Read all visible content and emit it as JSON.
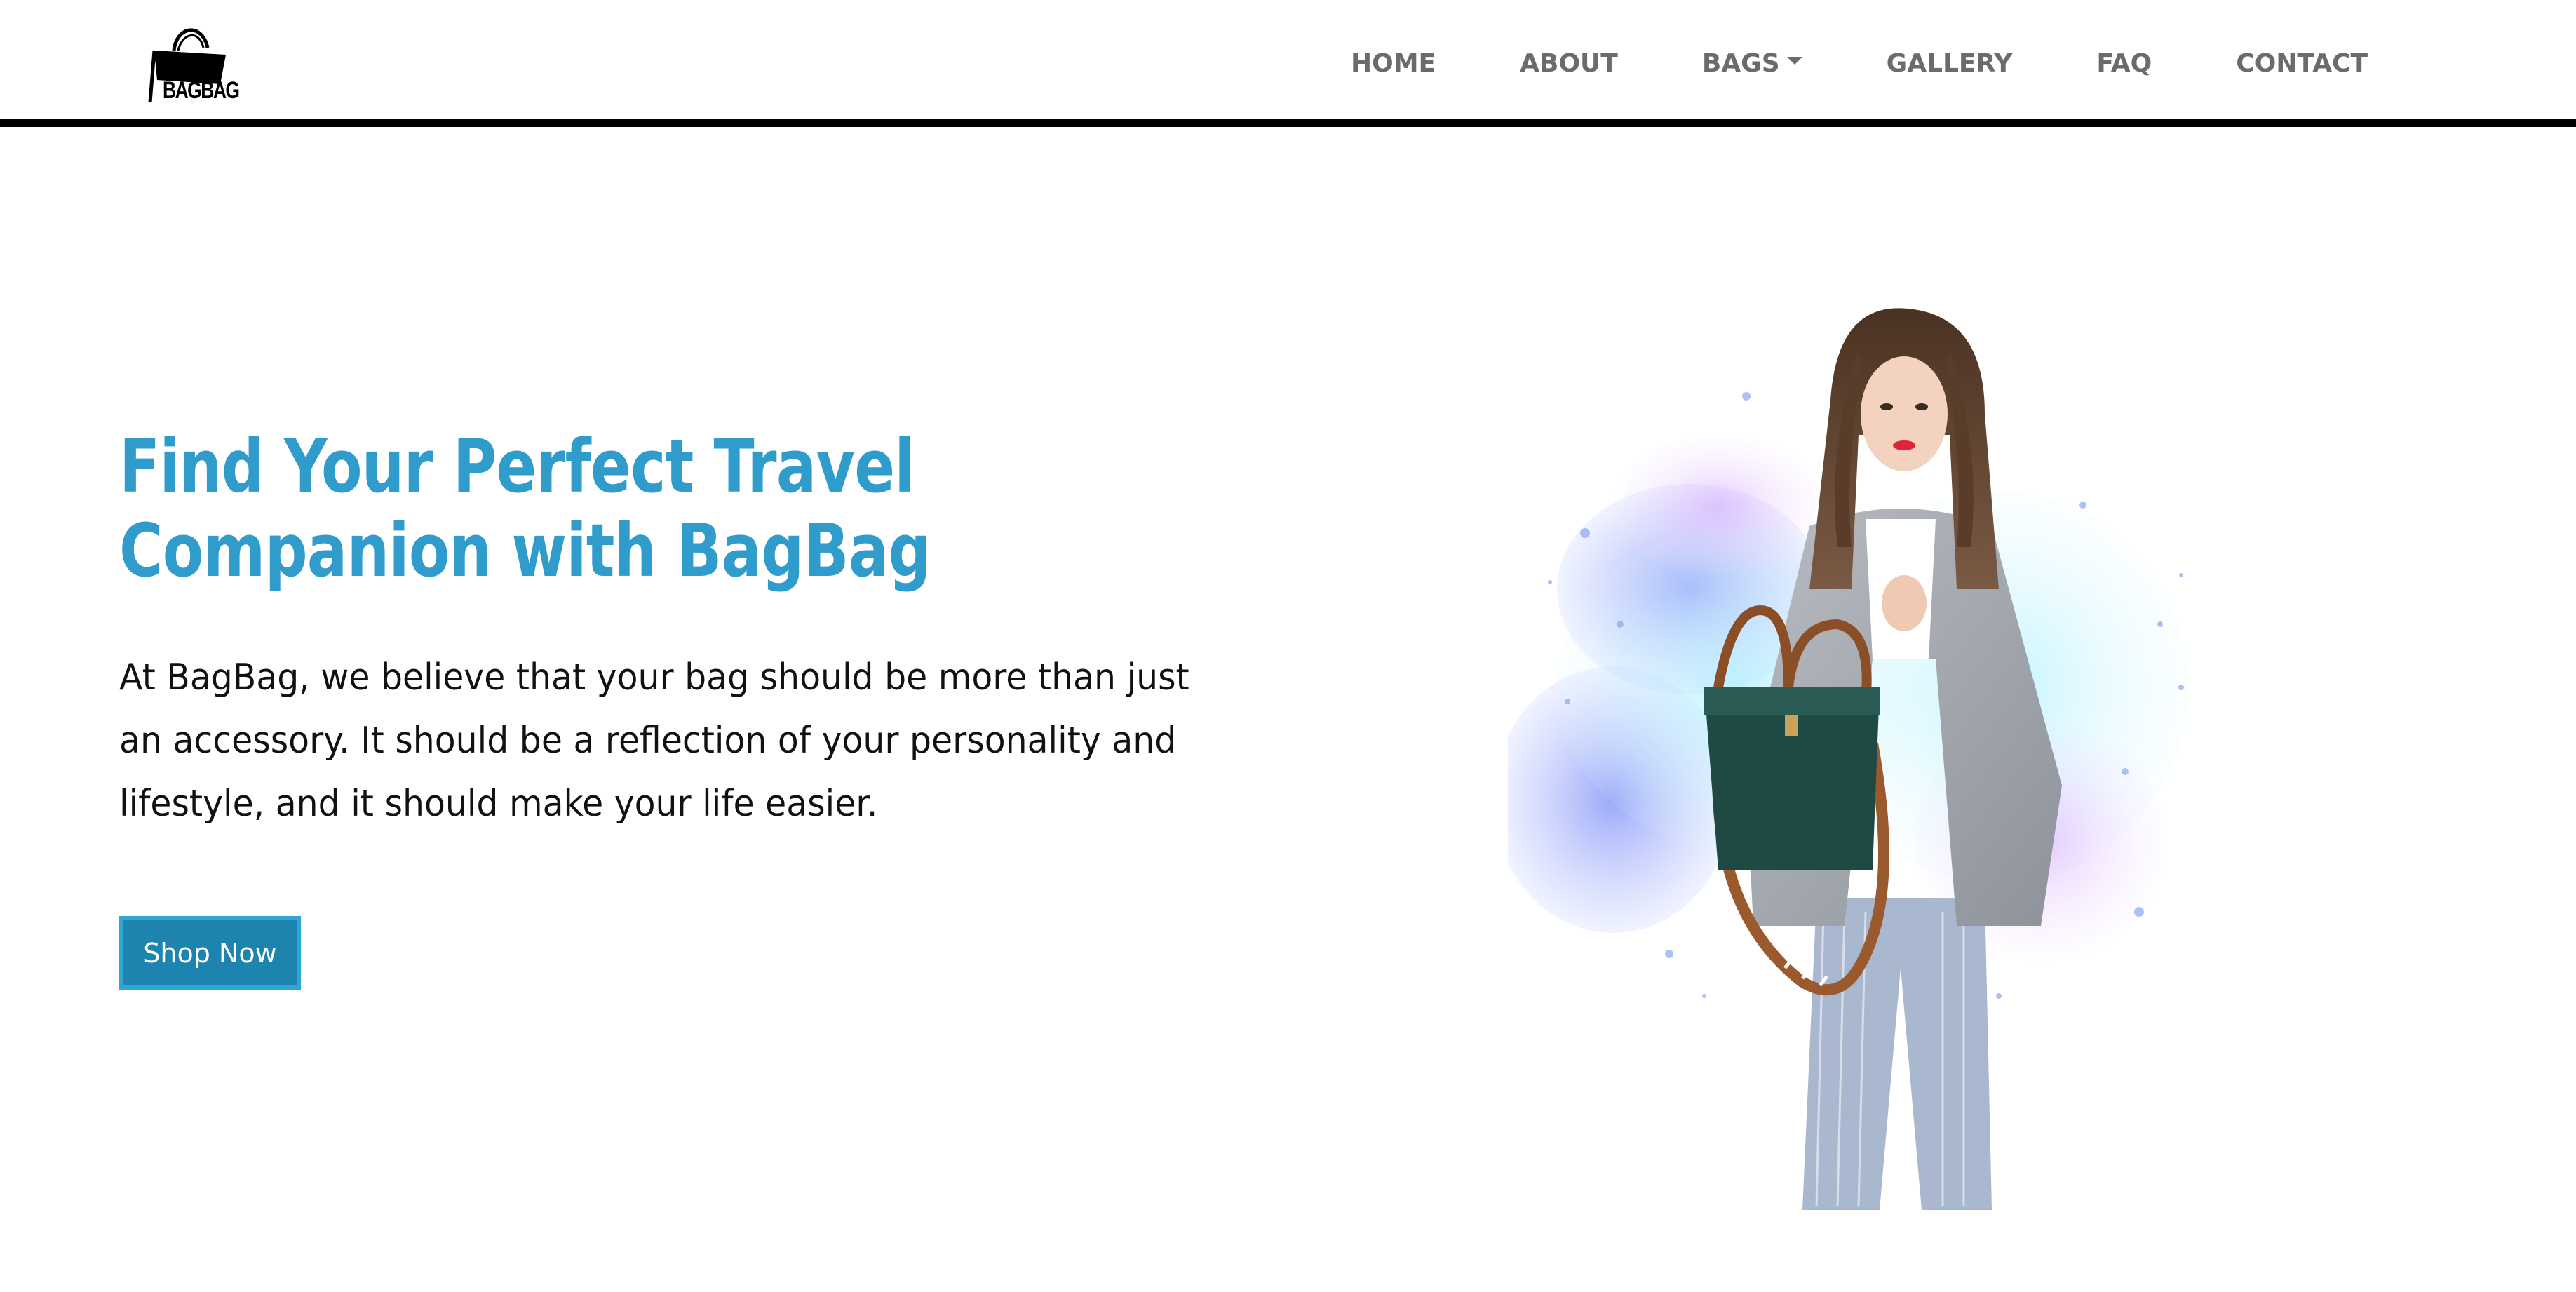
{
  "brand": {
    "name": "BAGBAG"
  },
  "nav": {
    "items": [
      {
        "label": "HOME"
      },
      {
        "label": "ABOUT"
      },
      {
        "label": "BAGS"
      },
      {
        "label": "GALLERY"
      },
      {
        "label": "FAQ"
      },
      {
        "label": "CONTACT"
      }
    ]
  },
  "hero": {
    "title": "Find Your Perfect Travel Companion with BagBag",
    "body": "At BagBag, we believe that your bag should be more than just an accessory. It should be a reflection of your personality and lifestyle, and it should make your life easier.",
    "cta_label": "Shop Now"
  },
  "colors": {
    "accent": "#2f9ccb",
    "button": "#1d84af",
    "nav_text": "#6b6b6b",
    "divider": "#000000"
  },
  "icons": {
    "logo": "handbag-logo-icon",
    "dropdown": "caret-down-icon"
  }
}
